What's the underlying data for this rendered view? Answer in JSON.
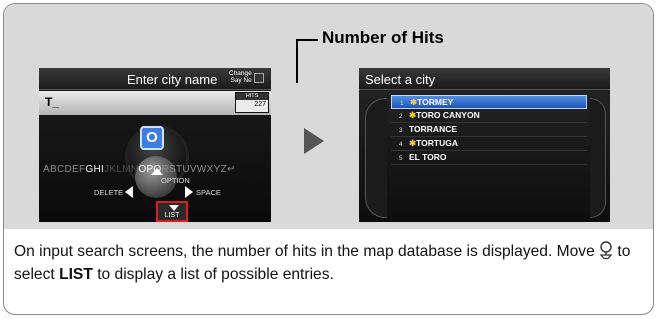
{
  "callout": {
    "label": "Number of Hits"
  },
  "screen1": {
    "title": "Enter city name",
    "change_line1": "Change",
    "change_line2": "Say Ne",
    "input_text": "T_",
    "hits_label": "HITS",
    "hits_value": "227",
    "selected_letter": "O",
    "letters_before": "ABCDEF",
    "letters_hi": "GHI",
    "letters_dim": "JKLMN",
    "letters_o": "O",
    "letters_pq": "PQ",
    "letters_after": "RSTUVWXYZ",
    "enter_glyph": "↵",
    "option_label": "OPTION",
    "delete_label": "DELETE",
    "space_label": "SPACE",
    "list_label": "LIST"
  },
  "screen2": {
    "title": "Select a city",
    "rows": [
      {
        "num": "1",
        "star": "✱",
        "name": "TORMEY"
      },
      {
        "num": "2",
        "star": "✱",
        "name": "TORO CANYON"
      },
      {
        "num": "3",
        "star": "",
        "name": "TORRANCE"
      },
      {
        "num": "4",
        "star": "✱",
        "name": "TORTUGA"
      },
      {
        "num": "5",
        "star": "",
        "name": "EL TORO"
      }
    ]
  },
  "caption": {
    "part1": "On input search screens, the number of hits in the map database is displayed. Move ",
    "part2": " to select ",
    "bold": "LIST",
    "part3": " to display a list of possible entries."
  },
  "colors": {
    "accent_blue": "#3d7fe0",
    "highlight_red": "#e01b1b",
    "star_yellow": "#f2c94c",
    "panel_gray": "#d9d9d9"
  },
  "icons": {
    "joystick": "joystick-icon",
    "next_arrow": "arrow-right-icon"
  }
}
